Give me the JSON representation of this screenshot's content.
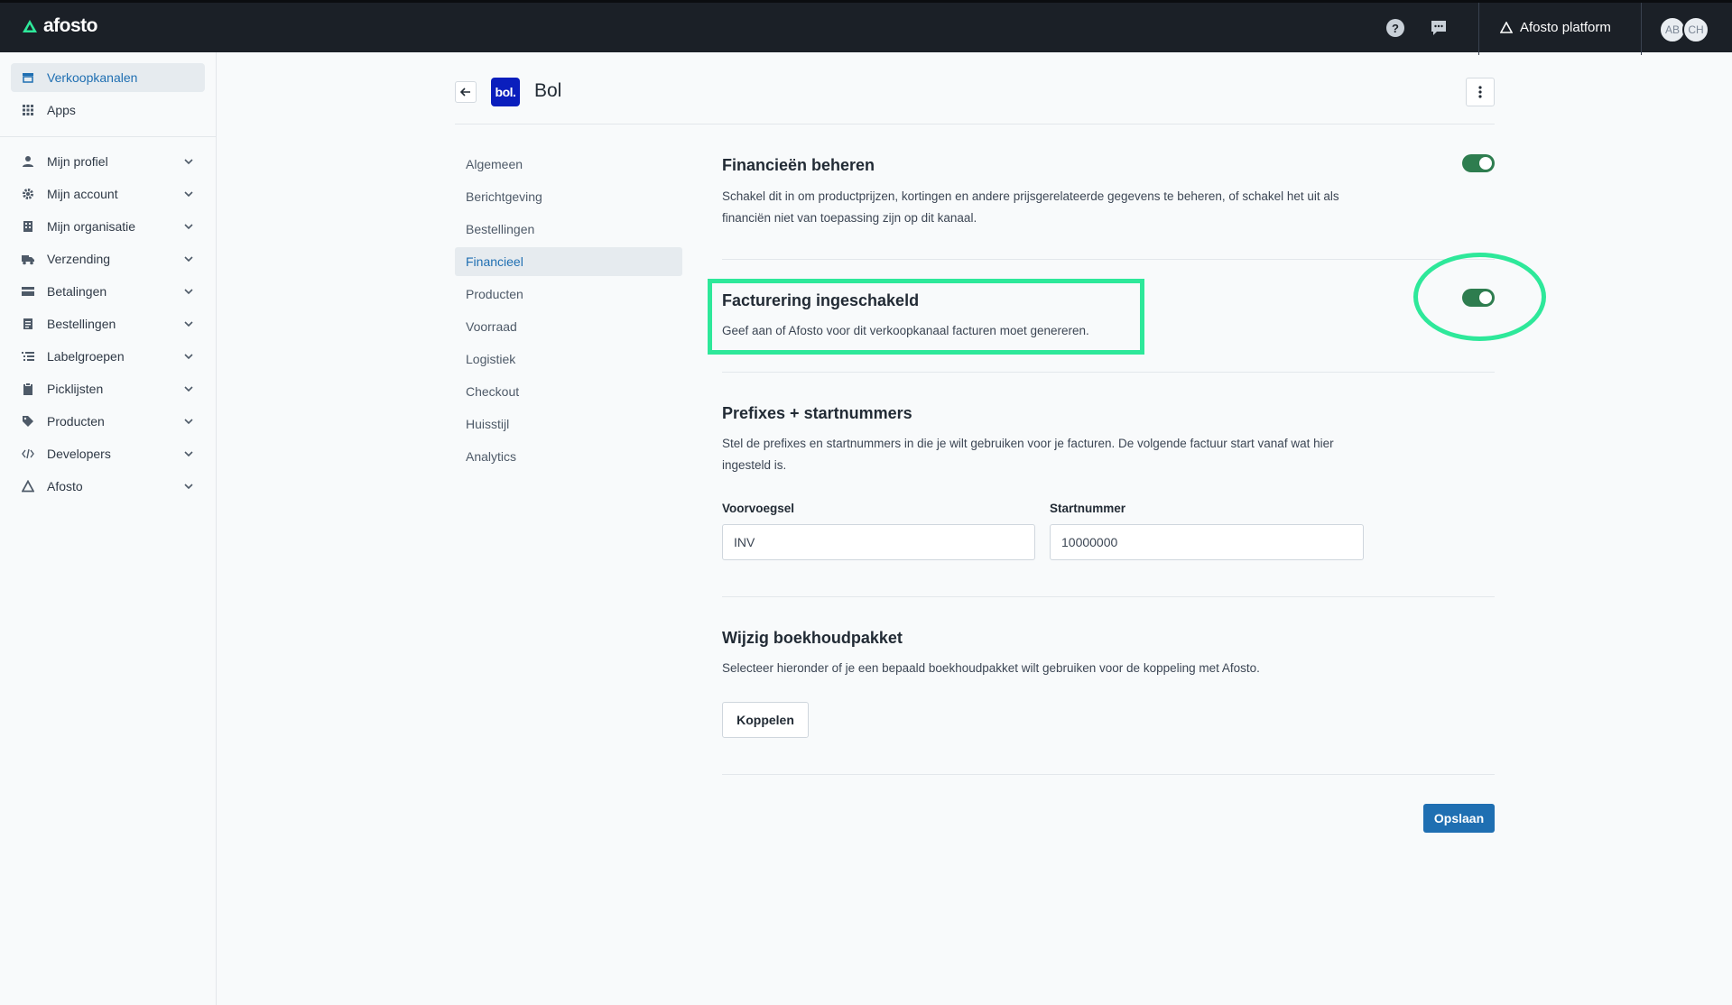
{
  "app": {
    "logo_text": "afosto",
    "platform_label": "Afosto platform",
    "avatars": [
      "AB",
      "CH"
    ],
    "brand_color": "#1b2027",
    "accent_color": "#1f6fb2",
    "toggle_color": "#2e7d4f",
    "highlight_color": "#2ee89a"
  },
  "sidebar": {
    "top_items": [
      {
        "label": "Verkoopkanalen",
        "icon": "storefront-icon",
        "active": true
      },
      {
        "label": "Apps",
        "icon": "grid-icon",
        "active": false
      }
    ],
    "items": [
      {
        "label": "Mijn profiel",
        "icon": "user-icon"
      },
      {
        "label": "Mijn account",
        "icon": "gear-icon"
      },
      {
        "label": "Mijn organisatie",
        "icon": "building-icon"
      },
      {
        "label": "Verzending",
        "icon": "truck-icon"
      },
      {
        "label": "Betalingen",
        "icon": "credit-card-icon"
      },
      {
        "label": "Bestellingen",
        "icon": "document-icon"
      },
      {
        "label": "Labelgroepen",
        "icon": "list-icon"
      },
      {
        "label": "Picklijsten",
        "icon": "clipboard-icon"
      },
      {
        "label": "Producten",
        "icon": "tag-icon"
      },
      {
        "label": "Developers",
        "icon": "code-icon"
      },
      {
        "label": "Afosto",
        "icon": "afosto-logo-icon"
      }
    ]
  },
  "page": {
    "channel_logo_text": "bol.",
    "title": "Bol"
  },
  "subnav": [
    {
      "label": "Algemeen",
      "active": false
    },
    {
      "label": "Berichtgeving",
      "active": false
    },
    {
      "label": "Bestellingen",
      "active": false
    },
    {
      "label": "Financieel",
      "active": true
    },
    {
      "label": "Producten",
      "active": false
    },
    {
      "label": "Voorraad",
      "active": false
    },
    {
      "label": "Logistiek",
      "active": false
    },
    {
      "label": "Checkout",
      "active": false
    },
    {
      "label": "Huisstijl",
      "active": false
    },
    {
      "label": "Analytics",
      "active": false
    }
  ],
  "sections": {
    "finances": {
      "title": "Financieën beheren",
      "description": "Schakel dit in om productprijzen, kortingen en andere prijsgerelateerde gegevens te beheren, of schakel het uit als financiën niet van toepassing zijn op dit kanaal.",
      "enabled": true
    },
    "invoicing": {
      "title": "Facturering ingeschakeld",
      "description": "Geef aan of Afosto voor dit verkoopkanaal facturen moet genereren.",
      "enabled": true
    },
    "prefixes": {
      "title": "Prefixes + startnummers",
      "description": "Stel de prefixes en startnummers in die je wilt gebruiken voor je facturen. De volgende factuur start vanaf wat hier ingesteld is.",
      "prefix_label": "Voorvoegsel",
      "prefix_value": "INV",
      "start_label": "Startnummer",
      "start_value": "10000000"
    },
    "accounting": {
      "title": "Wijzig boekhoudpakket",
      "description": "Selecteer hieronder of je een bepaald boekhoudpakket wilt gebruiken voor de koppeling met Afosto.",
      "button_label": "Koppelen"
    }
  },
  "actions": {
    "save_label": "Opslaan"
  }
}
